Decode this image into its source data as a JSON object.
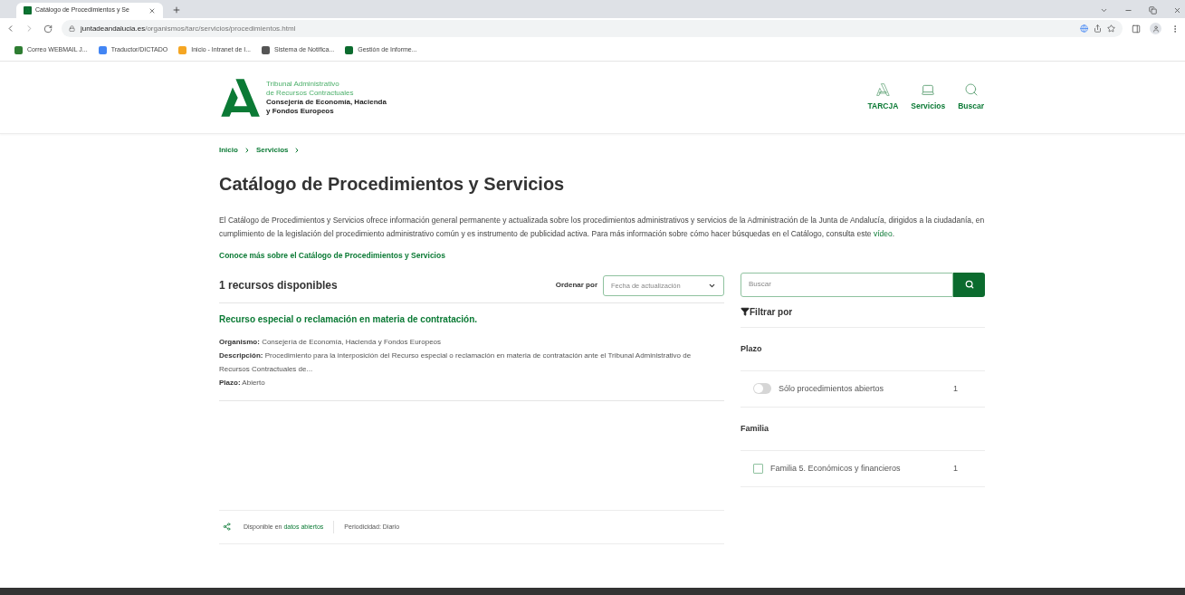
{
  "browser": {
    "tab": {
      "title": "Catálogo de Procedimientos y Se",
      "selected": true
    },
    "url_domain": "juntadeandalucia.es",
    "url_path": "/organismos/tarc/servicios/procedimientos.html",
    "bookmarks": [
      {
        "label": "Correo WEBMAIL J...",
        "color": "#2e7d32"
      },
      {
        "label": "Traductor/DICTADO",
        "color": "#4285f4"
      },
      {
        "label": "Inicio - Intranet de I...",
        "color": "#f5a623"
      },
      {
        "label": "Sistema de Notifica...",
        "color": "#555555"
      },
      {
        "label": "Gestión de Informe...",
        "color": "#0b6b2e"
      }
    ]
  },
  "header": {
    "logo_lines": [
      "Tribunal Administrativo",
      "de Recursos Contractuales"
    ],
    "logo_dept_lines": [
      "Consejería de Economía, Hacienda",
      "y Fondos Europeos"
    ],
    "nav": [
      {
        "label": "TARCJA",
        "kind": "logo"
      },
      {
        "label": "Servicios",
        "kind": "laptop"
      },
      {
        "label": "Buscar",
        "kind": "search"
      }
    ]
  },
  "breadcrumb": [
    "Inicio",
    "Servicios"
  ],
  "title": "Catálogo de Procedimientos y Servicios",
  "intro": {
    "before": "El Catálogo de Procedimientos y Servicios ofrece información general permanente y actualizada sobre los procedimientos administrativos y servicios de la Administración de la Junta de Andalucía, dirigidos a la ciudadanía, en cumplimiento de la legislación del procedimiento administrativo común y es instrumento de publicidad activa. Para más información sobre cómo hacer búsquedas en el Catálogo, consulta este ",
    "link": "vídeo",
    "after": "."
  },
  "more_link": "Conoce más sobre el Catálogo de Procedimientos y Servicios",
  "results": {
    "count": "1 recursos disponibles",
    "sort_label": "Ordenar por",
    "sort_value": "Fecha de actualización",
    "items": [
      {
        "title": "Recurso especial o reclamación en materia de contratación.",
        "fields": [
          {
            "label": "Organismo:",
            "value": "Consejería de Economía, Hacienda y Fondos Europeos"
          },
          {
            "label": "Descripción:",
            "value": "Procedimiento para la interposición del Recurso especial o reclamación en materia de contratación ante el Tribunal Administrativo de Recursos Contractuales de..."
          },
          {
            "label": "Plazo:",
            "value": "Abierto"
          }
        ]
      }
    ]
  },
  "search": {
    "placeholder": "Buscar"
  },
  "filters": {
    "title": "Filtrar por",
    "groups": [
      {
        "title": "Plazo",
        "options": [
          {
            "kind": "toggle",
            "label": "Sólo procedimientos abiertos",
            "count": "1",
            "on": false
          }
        ]
      },
      {
        "title": "Familia",
        "options": [
          {
            "kind": "checkbox",
            "label": "Familia 5. Económicos y financieros",
            "count": "1",
            "checked": false
          }
        ]
      }
    ]
  },
  "footer_info": {
    "prefix": "Disponible en",
    "link": "datos abiertos",
    "periodicity": "Periodicidad: Diario"
  }
}
